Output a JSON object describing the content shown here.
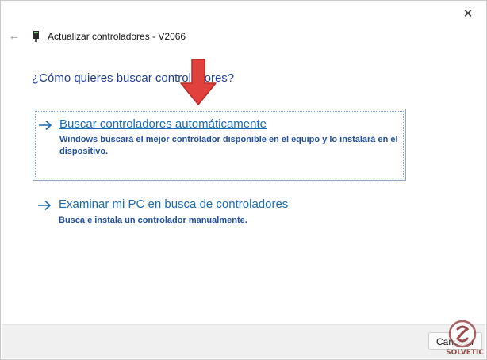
{
  "window": {
    "title": "Actualizar controladores - V2066",
    "close_symbol": "✕",
    "back_symbol": "←"
  },
  "heading": "¿Cómo quieres buscar controladores?",
  "options": [
    {
      "title": "Buscar controladores automáticamente",
      "description": "Windows buscará el mejor controlador disponible en el equipo y lo instalará en el dispositivo.",
      "icon": "arrow-right-icon"
    },
    {
      "title": "Examinar mi PC en busca de controladores",
      "description": "Busca e instala un controlador manualmente.",
      "icon": "arrow-right-icon"
    }
  ],
  "footer": {
    "cancel_label": "Cancelar"
  },
  "watermark": {
    "text": "SOLVETIC"
  },
  "colors": {
    "accent": "#1a6bb8",
    "heading": "#1f3e9a",
    "annotation_arrow": "#e0413c"
  }
}
